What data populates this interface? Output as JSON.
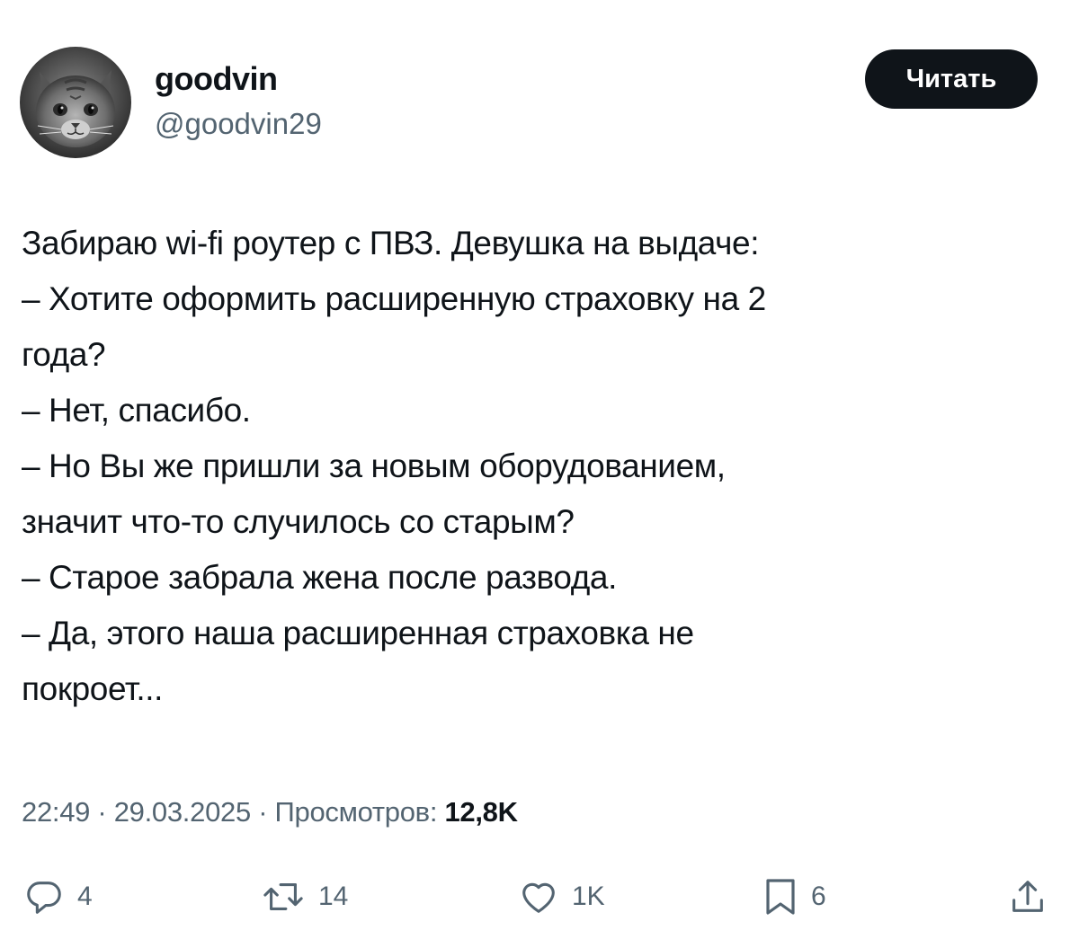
{
  "author": {
    "display_name": "goodvin",
    "handle": "@goodvin29",
    "avatar_icon": "cat-avatar"
  },
  "follow_button": {
    "label": "Читать",
    "background": "#0f1419",
    "text_color": "#ffffff"
  },
  "tweet": {
    "lines": [
      "Забираю wi-fi роутер с ПВЗ. Девушка на выдаче:",
      "– Хотите оформить расширенную страховку на 2",
      "года?",
      "– Нет, спасибо.",
      "– Но Вы же пришли за новым оборудованием,",
      "значит что-то случилось со старым?",
      "– Старое забрала жена после развода.",
      "– Да, этого наша расширенная страховка не",
      "покроет..."
    ]
  },
  "meta": {
    "time": "22:49",
    "separator": " · ",
    "date": "29.03.2025",
    "views_label": "Просмотров: ",
    "views_count": "12,8K"
  },
  "actions": {
    "reply": {
      "icon": "reply-icon",
      "count": "4"
    },
    "repost": {
      "icon": "repost-icon",
      "count": "14"
    },
    "like": {
      "icon": "heart-icon",
      "count": "1K"
    },
    "bookmark": {
      "icon": "bookmark-icon",
      "count": "6"
    },
    "share": {
      "icon": "share-icon"
    }
  },
  "colors": {
    "text_primary": "#0f1419",
    "text_secondary": "#536471",
    "background": "#ffffff"
  }
}
